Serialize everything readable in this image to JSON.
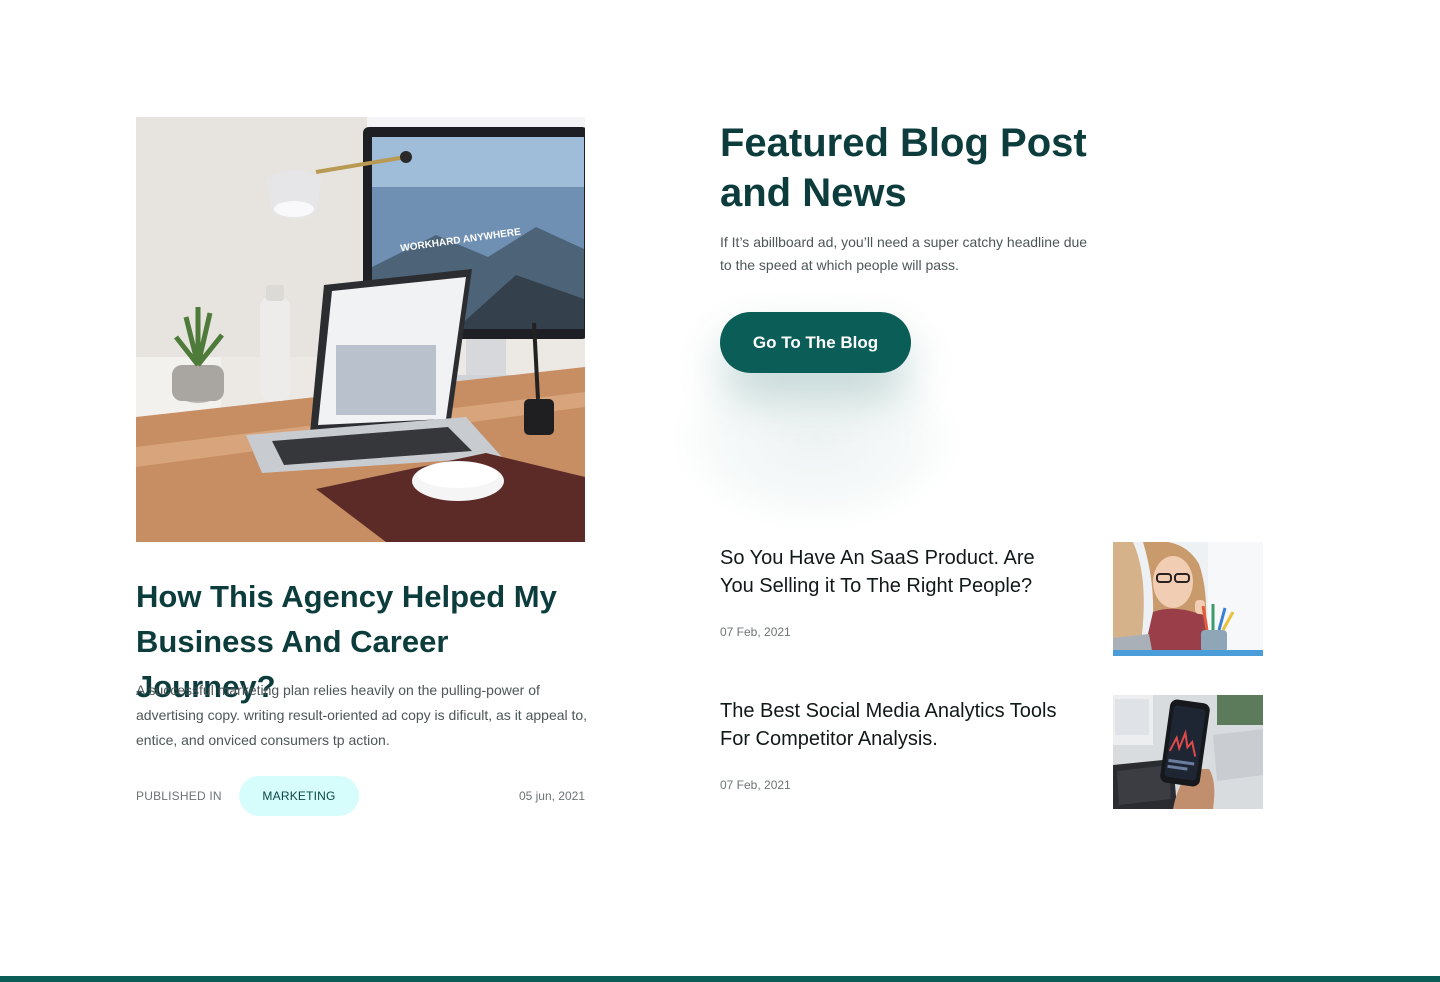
{
  "featured_post": {
    "image_icon": "desk-laptop-photo",
    "screen_text": "WORKHARD ANYWHERE",
    "title": "How This Agency Helped My Business And Career Journey?",
    "excerpt": "A successful marketing plan relies heavily on the pulling-power of advertising copy. writing result-oriented ad copy is dificult, as it appeal to, entice, and onviced consumers tp action.",
    "published_label": "PUBLISHED IN",
    "category": "MARKETING",
    "date": "05 jun, 2021"
  },
  "section": {
    "title": "Featured Blog Post and News",
    "subtitle": "If It’s abillboard ad, you’ll need a super catchy headline due to the speed at which people will pass.",
    "button_label": "Go To The Blog"
  },
  "posts": [
    {
      "title": "So You Have An SaaS Product. Are You Selling it To The Right People?",
      "date": "07 Feb, 2021",
      "thumb_icon": "woman-at-laptop-photo"
    },
    {
      "title": "The Best Social Media Analytics Tools For Competitor Analysis.",
      "date": "07 Feb, 2021",
      "thumb_icon": "phone-analytics-photo"
    }
  ],
  "colors": {
    "primary": "#0b5d57",
    "heading": "#0c3c3c",
    "tag_bg": "#d6fdfb",
    "body_text": "#4d5656",
    "meta_text": "#6c7474"
  }
}
